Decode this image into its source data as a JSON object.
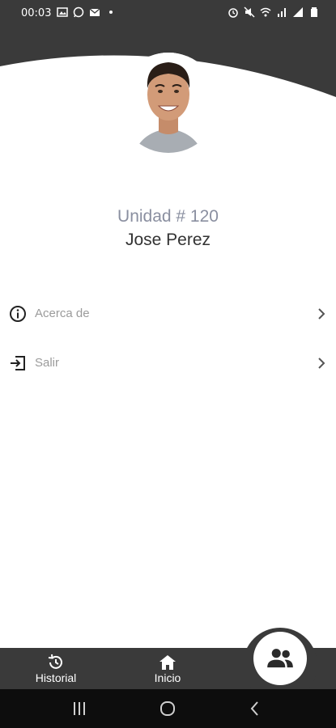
{
  "status_bar": {
    "time": "00:03",
    "left_icons": [
      "image-icon",
      "whatsapp-icon",
      "mail-icon",
      "dot-icon"
    ],
    "right_icons": [
      "alarm-icon",
      "mute-icon",
      "wifi-icon",
      "signal-icon",
      "signal-icon",
      "battery-icon"
    ]
  },
  "profile": {
    "unit": "Unidad # 120",
    "name": "Jose Perez"
  },
  "menu": {
    "items": [
      {
        "label": "Acerca de",
        "icon": "info-icon"
      },
      {
        "label": "Salir",
        "icon": "logout-icon"
      }
    ]
  },
  "bottom_nav": {
    "items": [
      {
        "label": "Historial",
        "icon": "history-icon"
      },
      {
        "label": "Inicio",
        "icon": "home-icon"
      }
    ],
    "fab_icon": "people-icon"
  },
  "colors": {
    "header": "#3a3a3a",
    "unit_text": "#8a8fa0",
    "name_text": "#333333",
    "menu_text": "#9b9b9b",
    "system_nav": "#0d0d0d"
  }
}
